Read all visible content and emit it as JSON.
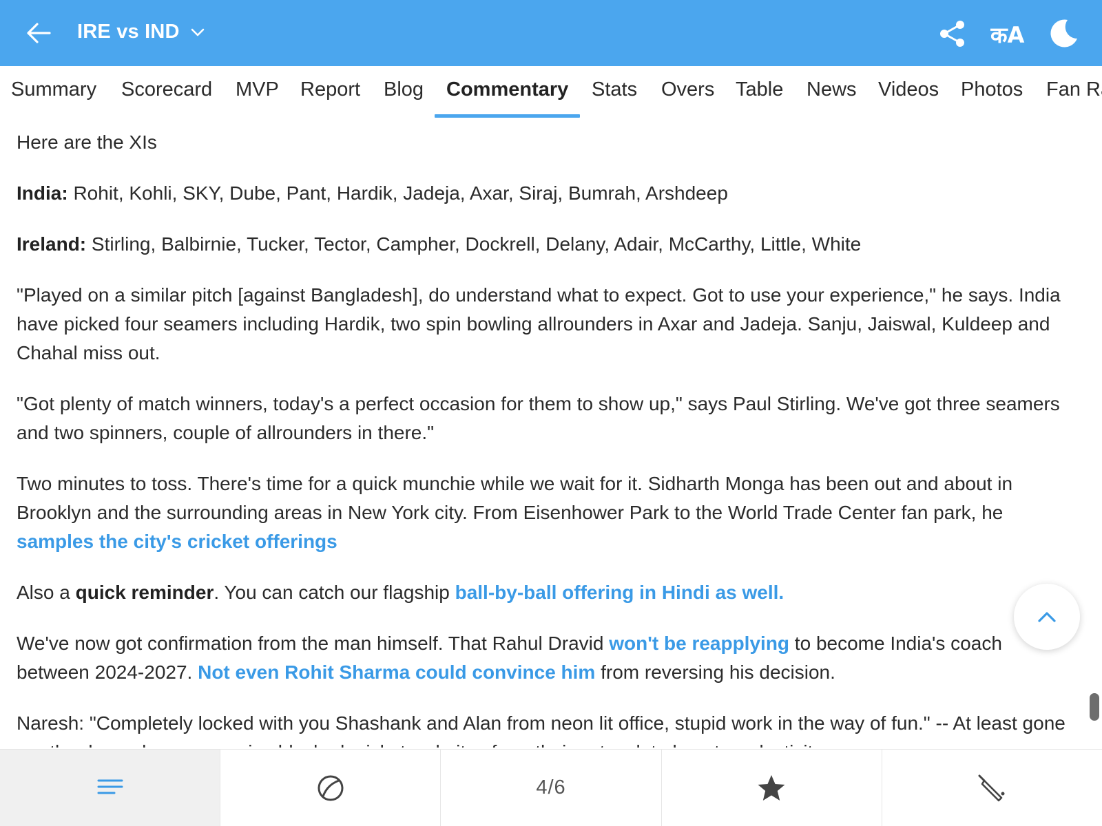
{
  "header": {
    "title": "IRE vs IND",
    "lang_icon_text": "कA"
  },
  "tabs": [
    {
      "label": "Summary"
    },
    {
      "label": "Scorecard"
    },
    {
      "label": "MVP"
    },
    {
      "label": "Report"
    },
    {
      "label": "Blog"
    },
    {
      "label": "Commentary",
      "active": true
    },
    {
      "label": "Stats"
    },
    {
      "label": "Overs"
    },
    {
      "label": "Table"
    },
    {
      "label": "News"
    },
    {
      "label": "Videos"
    },
    {
      "label": "Photos"
    },
    {
      "label": "Fan Ra"
    }
  ],
  "commentary": {
    "p1": "Here are the XIs",
    "india_label": "India:",
    "india_xi": " Rohit, Kohli, SKY, Dube, Pant, Hardik, Jadeja, Axar, Siraj, Bumrah, Arshdeep",
    "ireland_label": "Ireland:",
    "ireland_xi": " Stirling, Balbirnie, Tucker, Tector, Campher, Dockrell, Delany, Adair, McCarthy, Little, White",
    "p4": "\"Played on a similar pitch [against Bangladesh], do understand what to expect. Got to use your experience,\" he says. India have picked four seamers including Hardik, two spin bowling allrounders in Axar and Jadeja. Sanju, Jaiswal, Kuldeep and Chahal miss out.",
    "p5": "\"Got plenty of match winners, today's a perfect occasion for them to show up,\" says Paul Stirling. We've got three seamers and two spinners, couple of allrounders in there.\"",
    "p6_text": "Two minutes to toss. There's time for a quick munchie while we wait for it. Sidharth Monga has been out and about in Brooklyn and the surrounding areas in New York city. From Eisenhower Park to the World Trade Center fan park, he ",
    "p6_link": "samples the city's cricket offerings",
    "p7_a": "Also a ",
    "p7_bold": "quick reminder",
    "p7_b": ". You can catch our flagship ",
    "p7_link": "ball-by-ball offering in Hindi as well.",
    "p8_a": "We've now got confirmation from the man himself. That Rahul Dravid ",
    "p8_link1": "won't be reapplying",
    "p8_b": " to become India's coach between 2024-2027. ",
    "p8_link2": "Not even Rohit Sharma could convince him",
    "p8_c": " from reversing his decision.",
    "p9": "Naresh: \"Completely locked with you Shashank and Alan from neon lit office, stupid work in the way of fun.\" -- At least gone are the days when companies blocked cricket websites from their network to boost productivity."
  },
  "bottom_nav": {
    "page_indicator": "4/6",
    "icons": [
      "menu-icon",
      "ball-icon",
      "page-indicator",
      "star-icon",
      "bat-icon"
    ]
  },
  "colors": {
    "brand_blue": "#4ba6ee",
    "link_blue": "#3a9ae6"
  }
}
